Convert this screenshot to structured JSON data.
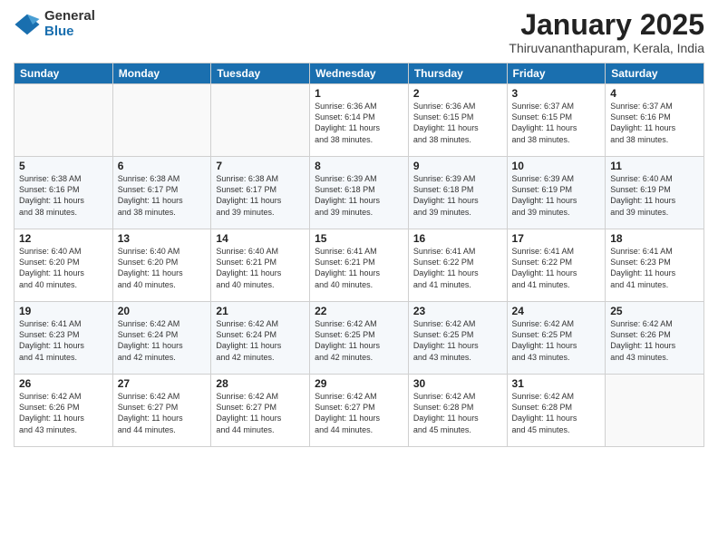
{
  "logo": {
    "general": "General",
    "blue": "Blue"
  },
  "header": {
    "title": "January 2025",
    "subtitle": "Thiruvananthapuram, Kerala, India"
  },
  "days": [
    "Sunday",
    "Monday",
    "Tuesday",
    "Wednesday",
    "Thursday",
    "Friday",
    "Saturday"
  ],
  "weeks": [
    [
      {
        "num": "",
        "info": ""
      },
      {
        "num": "",
        "info": ""
      },
      {
        "num": "",
        "info": ""
      },
      {
        "num": "1",
        "info": "Sunrise: 6:36 AM\nSunset: 6:14 PM\nDaylight: 11 hours\nand 38 minutes."
      },
      {
        "num": "2",
        "info": "Sunrise: 6:36 AM\nSunset: 6:15 PM\nDaylight: 11 hours\nand 38 minutes."
      },
      {
        "num": "3",
        "info": "Sunrise: 6:37 AM\nSunset: 6:15 PM\nDaylight: 11 hours\nand 38 minutes."
      },
      {
        "num": "4",
        "info": "Sunrise: 6:37 AM\nSunset: 6:16 PM\nDaylight: 11 hours\nand 38 minutes."
      }
    ],
    [
      {
        "num": "5",
        "info": "Sunrise: 6:38 AM\nSunset: 6:16 PM\nDaylight: 11 hours\nand 38 minutes."
      },
      {
        "num": "6",
        "info": "Sunrise: 6:38 AM\nSunset: 6:17 PM\nDaylight: 11 hours\nand 38 minutes."
      },
      {
        "num": "7",
        "info": "Sunrise: 6:38 AM\nSunset: 6:17 PM\nDaylight: 11 hours\nand 39 minutes."
      },
      {
        "num": "8",
        "info": "Sunrise: 6:39 AM\nSunset: 6:18 PM\nDaylight: 11 hours\nand 39 minutes."
      },
      {
        "num": "9",
        "info": "Sunrise: 6:39 AM\nSunset: 6:18 PM\nDaylight: 11 hours\nand 39 minutes."
      },
      {
        "num": "10",
        "info": "Sunrise: 6:39 AM\nSunset: 6:19 PM\nDaylight: 11 hours\nand 39 minutes."
      },
      {
        "num": "11",
        "info": "Sunrise: 6:40 AM\nSunset: 6:19 PM\nDaylight: 11 hours\nand 39 minutes."
      }
    ],
    [
      {
        "num": "12",
        "info": "Sunrise: 6:40 AM\nSunset: 6:20 PM\nDaylight: 11 hours\nand 40 minutes."
      },
      {
        "num": "13",
        "info": "Sunrise: 6:40 AM\nSunset: 6:20 PM\nDaylight: 11 hours\nand 40 minutes."
      },
      {
        "num": "14",
        "info": "Sunrise: 6:40 AM\nSunset: 6:21 PM\nDaylight: 11 hours\nand 40 minutes."
      },
      {
        "num": "15",
        "info": "Sunrise: 6:41 AM\nSunset: 6:21 PM\nDaylight: 11 hours\nand 40 minutes."
      },
      {
        "num": "16",
        "info": "Sunrise: 6:41 AM\nSunset: 6:22 PM\nDaylight: 11 hours\nand 41 minutes."
      },
      {
        "num": "17",
        "info": "Sunrise: 6:41 AM\nSunset: 6:22 PM\nDaylight: 11 hours\nand 41 minutes."
      },
      {
        "num": "18",
        "info": "Sunrise: 6:41 AM\nSunset: 6:23 PM\nDaylight: 11 hours\nand 41 minutes."
      }
    ],
    [
      {
        "num": "19",
        "info": "Sunrise: 6:41 AM\nSunset: 6:23 PM\nDaylight: 11 hours\nand 41 minutes."
      },
      {
        "num": "20",
        "info": "Sunrise: 6:42 AM\nSunset: 6:24 PM\nDaylight: 11 hours\nand 42 minutes."
      },
      {
        "num": "21",
        "info": "Sunrise: 6:42 AM\nSunset: 6:24 PM\nDaylight: 11 hours\nand 42 minutes."
      },
      {
        "num": "22",
        "info": "Sunrise: 6:42 AM\nSunset: 6:25 PM\nDaylight: 11 hours\nand 42 minutes."
      },
      {
        "num": "23",
        "info": "Sunrise: 6:42 AM\nSunset: 6:25 PM\nDaylight: 11 hours\nand 43 minutes."
      },
      {
        "num": "24",
        "info": "Sunrise: 6:42 AM\nSunset: 6:25 PM\nDaylight: 11 hours\nand 43 minutes."
      },
      {
        "num": "25",
        "info": "Sunrise: 6:42 AM\nSunset: 6:26 PM\nDaylight: 11 hours\nand 43 minutes."
      }
    ],
    [
      {
        "num": "26",
        "info": "Sunrise: 6:42 AM\nSunset: 6:26 PM\nDaylight: 11 hours\nand 43 minutes."
      },
      {
        "num": "27",
        "info": "Sunrise: 6:42 AM\nSunset: 6:27 PM\nDaylight: 11 hours\nand 44 minutes."
      },
      {
        "num": "28",
        "info": "Sunrise: 6:42 AM\nSunset: 6:27 PM\nDaylight: 11 hours\nand 44 minutes."
      },
      {
        "num": "29",
        "info": "Sunrise: 6:42 AM\nSunset: 6:27 PM\nDaylight: 11 hours\nand 44 minutes."
      },
      {
        "num": "30",
        "info": "Sunrise: 6:42 AM\nSunset: 6:28 PM\nDaylight: 11 hours\nand 45 minutes."
      },
      {
        "num": "31",
        "info": "Sunrise: 6:42 AM\nSunset: 6:28 PM\nDaylight: 11 hours\nand 45 minutes."
      },
      {
        "num": "",
        "info": ""
      }
    ]
  ]
}
